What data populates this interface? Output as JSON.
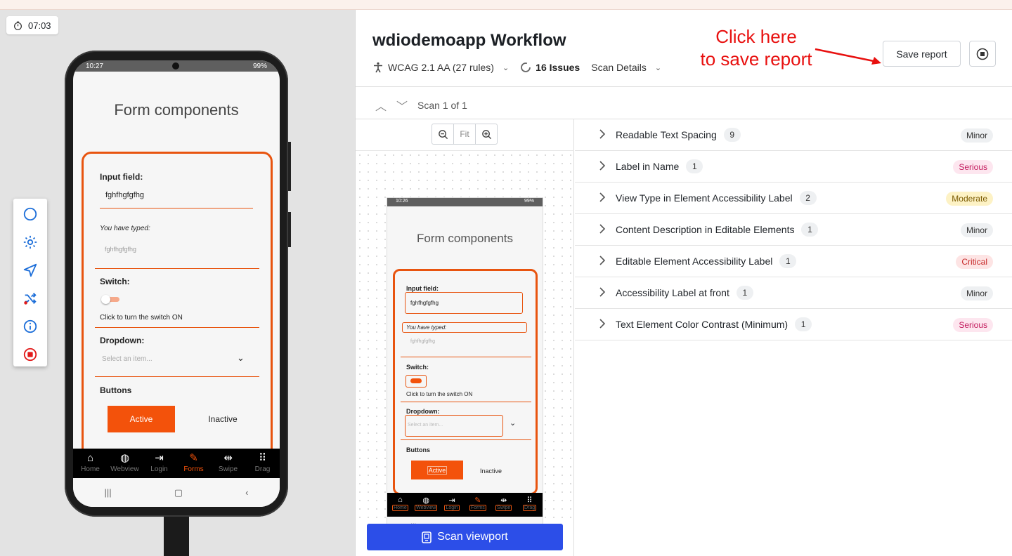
{
  "timer": {
    "value": "07:03"
  },
  "phone": {
    "status_time": "10:27",
    "status_right": "99%",
    "form_title": "Form components",
    "input_label": "Input field:",
    "input_value": "fghfhgfgfhg",
    "typed_label": "You have typed:",
    "typed_value": "fghfhgfgfhg",
    "switch_label": "Switch:",
    "switch_hint": "Click to turn the switch ON",
    "dropdown_label": "Dropdown:",
    "dropdown_placeholder": "Select an item...",
    "buttons_label": "Buttons",
    "btn_active": "Active",
    "btn_inactive": "Inactive",
    "tabs": [
      {
        "label": "Home",
        "icon": "home-icon"
      },
      {
        "label": "Webview",
        "icon": "globe-icon"
      },
      {
        "label": "Login",
        "icon": "login-icon"
      },
      {
        "label": "Forms",
        "icon": "pencil-icon"
      },
      {
        "label": "Swipe",
        "icon": "swipe-icon"
      },
      {
        "label": "Drag",
        "icon": "grid-icon"
      }
    ]
  },
  "panel": {
    "title": "wdiodemoapp Workflow",
    "standard": "WCAG 2.1 AA (27 rules)",
    "issues_count": "16 Issues",
    "scan_details": "Scan Details",
    "save_report": "Save report",
    "annotation": [
      "Click here",
      "to save report"
    ],
    "scan_label": "Scan 1 of 1",
    "zoom_fit": "Fit",
    "scan_viewport": "Scan viewport"
  },
  "preview": {
    "status_time": "10:26",
    "status_right": "99%"
  },
  "issues": [
    {
      "name": "Readable Text Spacing",
      "count": "9",
      "severity": "Minor"
    },
    {
      "name": "Label in Name",
      "count": "1",
      "severity": "Serious"
    },
    {
      "name": "View Type in Element Accessibility Label",
      "count": "2",
      "severity": "Moderate"
    },
    {
      "name": "Content Description in Editable Elements",
      "count": "1",
      "severity": "Minor"
    },
    {
      "name": "Editable Element Accessibility Label",
      "count": "1",
      "severity": "Critical"
    },
    {
      "name": "Accessibility Label at front",
      "count": "1",
      "severity": "Minor"
    },
    {
      "name": "Text Element Color Contrast (Minimum)",
      "count": "1",
      "severity": "Serious"
    }
  ],
  "colors": {
    "accent_orange": "#e8540f",
    "scan_button": "#2c4ee8",
    "annotation_red": "#e8100f"
  }
}
